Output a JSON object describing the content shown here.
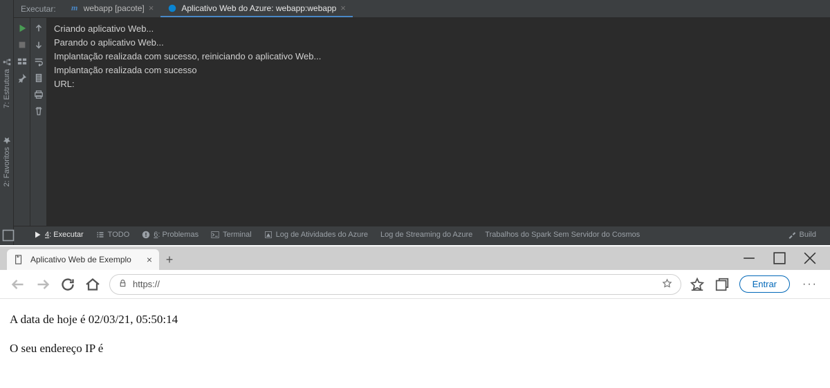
{
  "ide": {
    "leftStripe": {
      "structure": "7: Estrutura",
      "favorites": "2: Favoritos"
    },
    "runTabs": {
      "label": "Executar:",
      "tab1": {
        "name": "webapp [pacote]"
      },
      "tab2": {
        "name": "Aplicativo Web do Azure: webapp:webapp"
      }
    },
    "console": {
      "lines": [
        "Criando aplicativo Web...",
        "Parando o aplicativo Web...",
        "Implantação realizada com sucesso, reiniciando o aplicativo Web...",
        "Implantação realizada com sucesso",
        "URL:"
      ]
    },
    "bottomTabs": {
      "run": "4: Executar",
      "todo": "TODO",
      "problems": "6: Problemas",
      "terminal": "Terminal",
      "azureLog": "Log de Atividades do Azure",
      "streamLog": "Log de Streaming do Azure",
      "spark": "Trabalhos do Spark Sem Servidor do Cosmos",
      "build": "Build"
    }
  },
  "browser": {
    "tabTitle": "Aplicativo Web de Exemplo",
    "url": "https://",
    "signIn": "Entrar",
    "page": {
      "line1": "A data de hoje é 02/03/21, 05:50:14",
      "line2": "O seu endereço IP é"
    }
  }
}
